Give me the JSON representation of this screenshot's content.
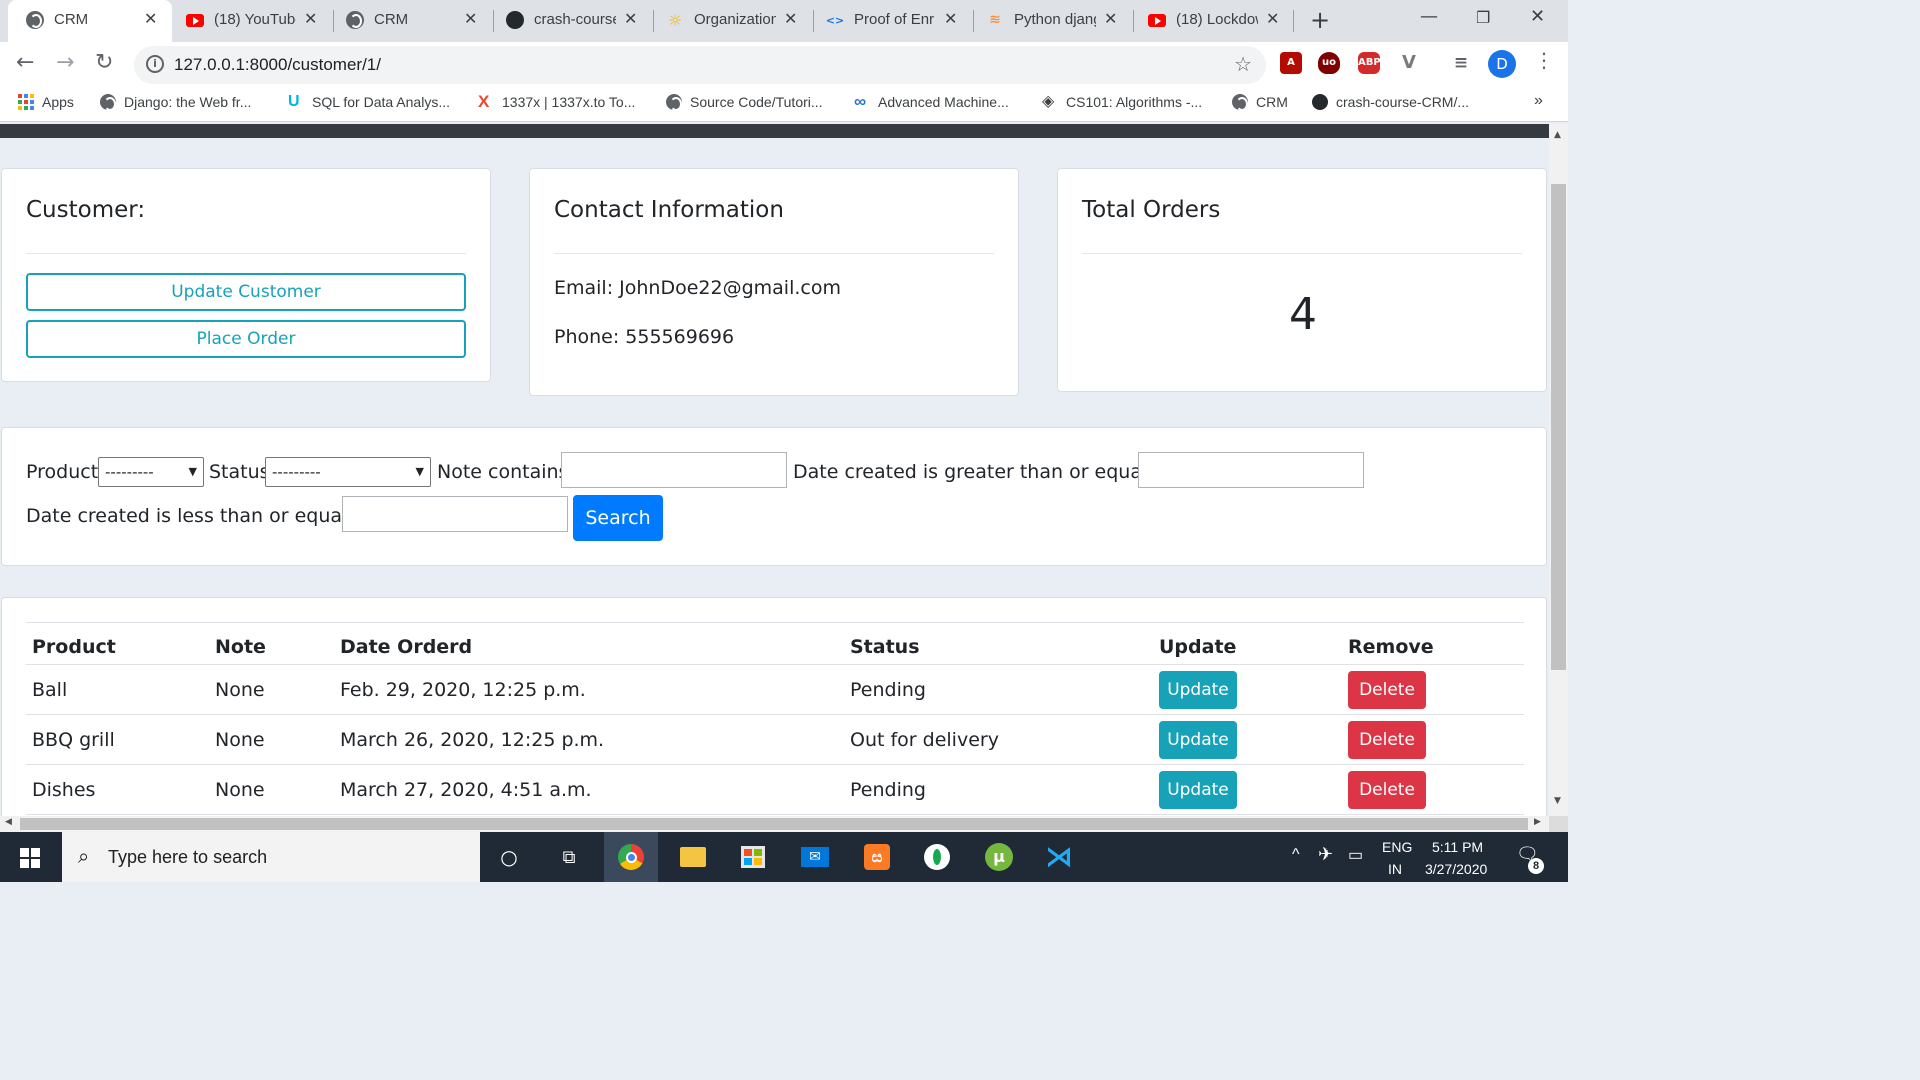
{
  "browser": {
    "tabs": [
      {
        "title": "CRM",
        "icon": "globe-icon"
      },
      {
        "title": "(18) YouTube",
        "icon": "youtube-icon"
      },
      {
        "title": "CRM",
        "icon": "globe-icon"
      },
      {
        "title": "crash-course",
        "icon": "github-icon"
      },
      {
        "title": "Organization",
        "icon": "organization-icon"
      },
      {
        "title": "Proof of Enr",
        "icon": "code-icon"
      },
      {
        "title": "Python djang",
        "icon": "stackoverflow-icon"
      },
      {
        "title": "(18) Lockdow",
        "icon": "youtube-icon"
      }
    ],
    "url": "127.0.0.1:8000/customer/1/",
    "avatar_letter": "D",
    "bookmarks": [
      {
        "label": "Apps",
        "icon": "apps-grid-icon"
      },
      {
        "label": "Django: the Web fr...",
        "icon": "globe-icon"
      },
      {
        "label": "SQL for Data Analys...",
        "icon": "udacity-icon"
      },
      {
        "label": "1337x | 1337x.to To...",
        "icon": "x-icon"
      },
      {
        "label": "Source Code/Tutori...",
        "icon": "globe-icon"
      },
      {
        "label": "Advanced Machine...",
        "icon": "infinity-icon"
      },
      {
        "label": "CS101: Algorithms -...",
        "icon": "diamond-icon"
      },
      {
        "label": "CRM",
        "icon": "globe-icon"
      },
      {
        "label": "crash-course-CRM/...",
        "icon": "github-icon"
      }
    ],
    "more_bookmarks": "»"
  },
  "customer_card": {
    "title": "Customer:",
    "update_label": "Update Customer",
    "place_order_label": "Place Order"
  },
  "contact_card": {
    "title": "Contact Information",
    "email": "Email: JohnDoe22@gmail.com",
    "phone": "Phone: 555569696"
  },
  "orders_card": {
    "title": "Total Orders",
    "count": "4"
  },
  "filter": {
    "product_label": "Product:",
    "product_value": "---------",
    "status_label": "Status:",
    "status_value": "---------",
    "note_label": "Note contains:",
    "date_gte_label": "Date created is greater than or equal to:",
    "date_lte_label": "Date created is less than or equal to:",
    "search_label": "Search"
  },
  "orders_table": {
    "headers": [
      "Product",
      "Note",
      "Date Orderd",
      "Status",
      "Update",
      "Remove"
    ],
    "rows": [
      {
        "product": "Ball",
        "note": "None",
        "date": "Feb. 29, 2020, 12:25 p.m.",
        "status": "Pending",
        "update": "Update",
        "remove": "Delete"
      },
      {
        "product": "BBQ grill",
        "note": "None",
        "date": "March 26, 2020, 12:25 p.m.",
        "status": "Out for delivery",
        "update": "Update",
        "remove": "Delete"
      },
      {
        "product": "Dishes",
        "note": "None",
        "date": "March 27, 2020, 4:51 a.m.",
        "status": "Pending",
        "update": "Update",
        "remove": "Delete"
      }
    ]
  },
  "taskbar": {
    "search_placeholder": "Type here to search",
    "lang_top": "ENG",
    "lang_bottom": "IN",
    "time": "5:11 PM",
    "date": "3/27/2020",
    "notification_count": "8"
  },
  "colors": {
    "info": "#17a2b8",
    "primary": "#007bff",
    "danger": "#dc3545",
    "page_bg": "#e9edf4",
    "navbar": "#343a40"
  }
}
